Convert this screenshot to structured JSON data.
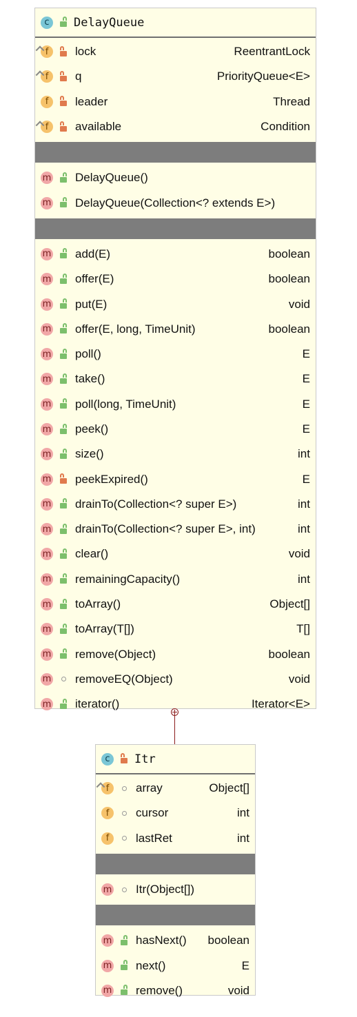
{
  "delay_queue": {
    "kind_icon": "class-icon",
    "visibility": "public",
    "title": "DelayQueue",
    "fields": [
      {
        "name": "lock",
        "type": "ReentrantLock",
        "visibility": "private",
        "final": true
      },
      {
        "name": "q",
        "type": "PriorityQueue<E>",
        "visibility": "private",
        "final": true
      },
      {
        "name": "leader",
        "type": "Thread",
        "visibility": "private",
        "final": false
      },
      {
        "name": "available",
        "type": "Condition",
        "visibility": "private",
        "final": true
      }
    ],
    "constructors": [
      {
        "name": "DelayQueue()",
        "type": "",
        "visibility": "public"
      },
      {
        "name": "DelayQueue(Collection<? extends E>)",
        "type": "",
        "visibility": "public"
      }
    ],
    "methods": [
      {
        "name": "add(E)",
        "type": "boolean",
        "visibility": "public"
      },
      {
        "name": "offer(E)",
        "type": "boolean",
        "visibility": "public"
      },
      {
        "name": "put(E)",
        "type": "void",
        "visibility": "public"
      },
      {
        "name": "offer(E, long, TimeUnit)",
        "type": "boolean",
        "visibility": "public"
      },
      {
        "name": "poll()",
        "type": "E",
        "visibility": "public"
      },
      {
        "name": "take()",
        "type": "E",
        "visibility": "public"
      },
      {
        "name": "poll(long, TimeUnit)",
        "type": "E",
        "visibility": "public"
      },
      {
        "name": "peek()",
        "type": "E",
        "visibility": "public"
      },
      {
        "name": "size()",
        "type": "int",
        "visibility": "public"
      },
      {
        "name": "peekExpired()",
        "type": "E",
        "visibility": "private"
      },
      {
        "name": "drainTo(Collection<? super E>)",
        "type": "int",
        "visibility": "public"
      },
      {
        "name": "drainTo(Collection<? super E>, int)",
        "type": "int",
        "visibility": "public"
      },
      {
        "name": "clear()",
        "type": "void",
        "visibility": "public"
      },
      {
        "name": "remainingCapacity()",
        "type": "int",
        "visibility": "public"
      },
      {
        "name": "toArray()",
        "type": "Object[]",
        "visibility": "public"
      },
      {
        "name": "toArray(T[])",
        "type": "T[]",
        "visibility": "public"
      },
      {
        "name": "remove(Object)",
        "type": "boolean",
        "visibility": "public"
      },
      {
        "name": "removeEQ(Object)",
        "type": "void",
        "visibility": "package"
      },
      {
        "name": "iterator()",
        "type": "Iterator<E>",
        "visibility": "public"
      }
    ]
  },
  "itr": {
    "kind_icon": "class-icon",
    "visibility": "private",
    "title": "Itr",
    "fields": [
      {
        "name": "array",
        "type": "Object[]",
        "visibility": "package",
        "final": true
      },
      {
        "name": "cursor",
        "type": "int",
        "visibility": "package",
        "final": false
      },
      {
        "name": "lastRet",
        "type": "int",
        "visibility": "package",
        "final": false
      }
    ],
    "constructors": [
      {
        "name": "Itr(Object[])",
        "type": "",
        "visibility": "package"
      }
    ],
    "methods": [
      {
        "name": "hasNext()",
        "type": "boolean",
        "visibility": "public"
      },
      {
        "name": "next()",
        "type": "E",
        "visibility": "public"
      },
      {
        "name": "remove()",
        "type": "void",
        "visibility": "public"
      }
    ]
  },
  "relation": {
    "type": "inner-class",
    "icon": "nested-class-connector"
  },
  "colors": {
    "class_bg": "#fffee6",
    "separator": "#7d7d7d",
    "field_badge": "#f6c26b",
    "method_badge": "#f1a7a7",
    "class_badge": "#7ac6d6",
    "private_lock": "#e07a4d",
    "public_lock": "#7cbf6c",
    "connector": "#8a1a1a"
  }
}
